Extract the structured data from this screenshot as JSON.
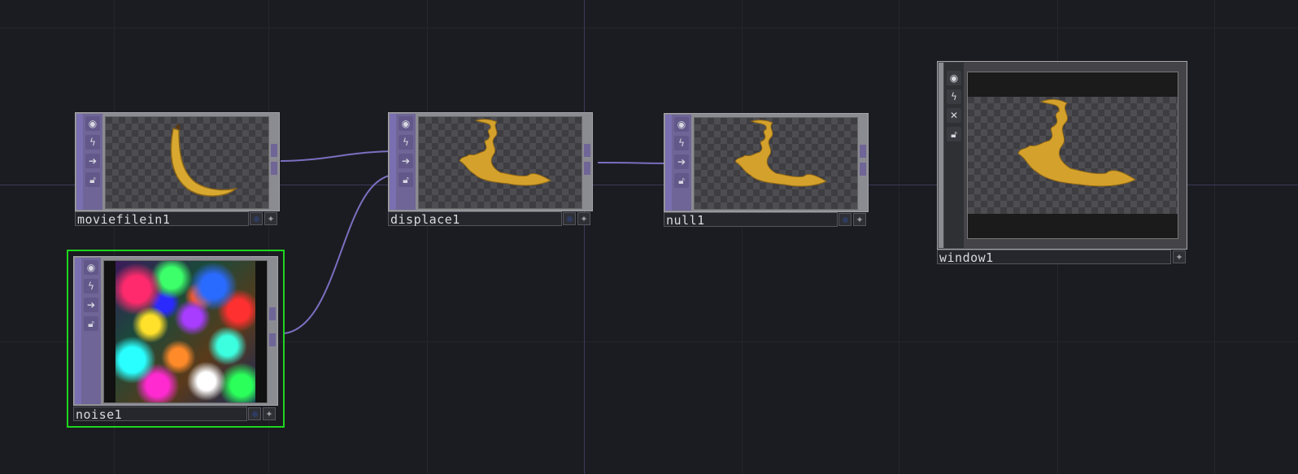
{
  "colors": {
    "background": "#1b1c21",
    "wire": "#7a6fc0",
    "selection": "#1ed61e",
    "node_strip": "#7a6fb0"
  },
  "nodes": [
    {
      "id": "moviefilein1",
      "label": "moviefilein1",
      "preview": "banana",
      "icons": [
        "viewer-toggle-icon",
        "bypass-icon",
        "display-arrow-icon",
        "lock-icon"
      ],
      "selected": false
    },
    {
      "id": "displace1",
      "label": "displace1",
      "preview": "distorted-splash",
      "icons": [
        "viewer-toggle-icon",
        "bypass-icon",
        "display-arrow-icon",
        "lock-icon"
      ],
      "selected": false
    },
    {
      "id": "null1",
      "label": "null1",
      "preview": "distorted-splash",
      "icons": [
        "viewer-toggle-icon",
        "bypass-icon",
        "display-arrow-icon",
        "lock-icon"
      ],
      "selected": false
    },
    {
      "id": "window1",
      "label": "window1",
      "preview": "distorted-splash-letterbox",
      "icons": [
        "viewer-toggle-icon",
        "bypass-icon",
        "close-icon",
        "lock-icon"
      ],
      "selected": false
    },
    {
      "id": "noise1",
      "label": "noise1",
      "preview": "color-noise",
      "icons": [
        "viewer-toggle-icon",
        "bypass-icon",
        "display-arrow-icon",
        "lock-icon"
      ],
      "selected": true
    }
  ],
  "connections": [
    {
      "from": "moviefilein1",
      "to": "displace1"
    },
    {
      "from": "noise1",
      "to": "displace1"
    },
    {
      "from": "displace1",
      "to": "null1"
    }
  ]
}
